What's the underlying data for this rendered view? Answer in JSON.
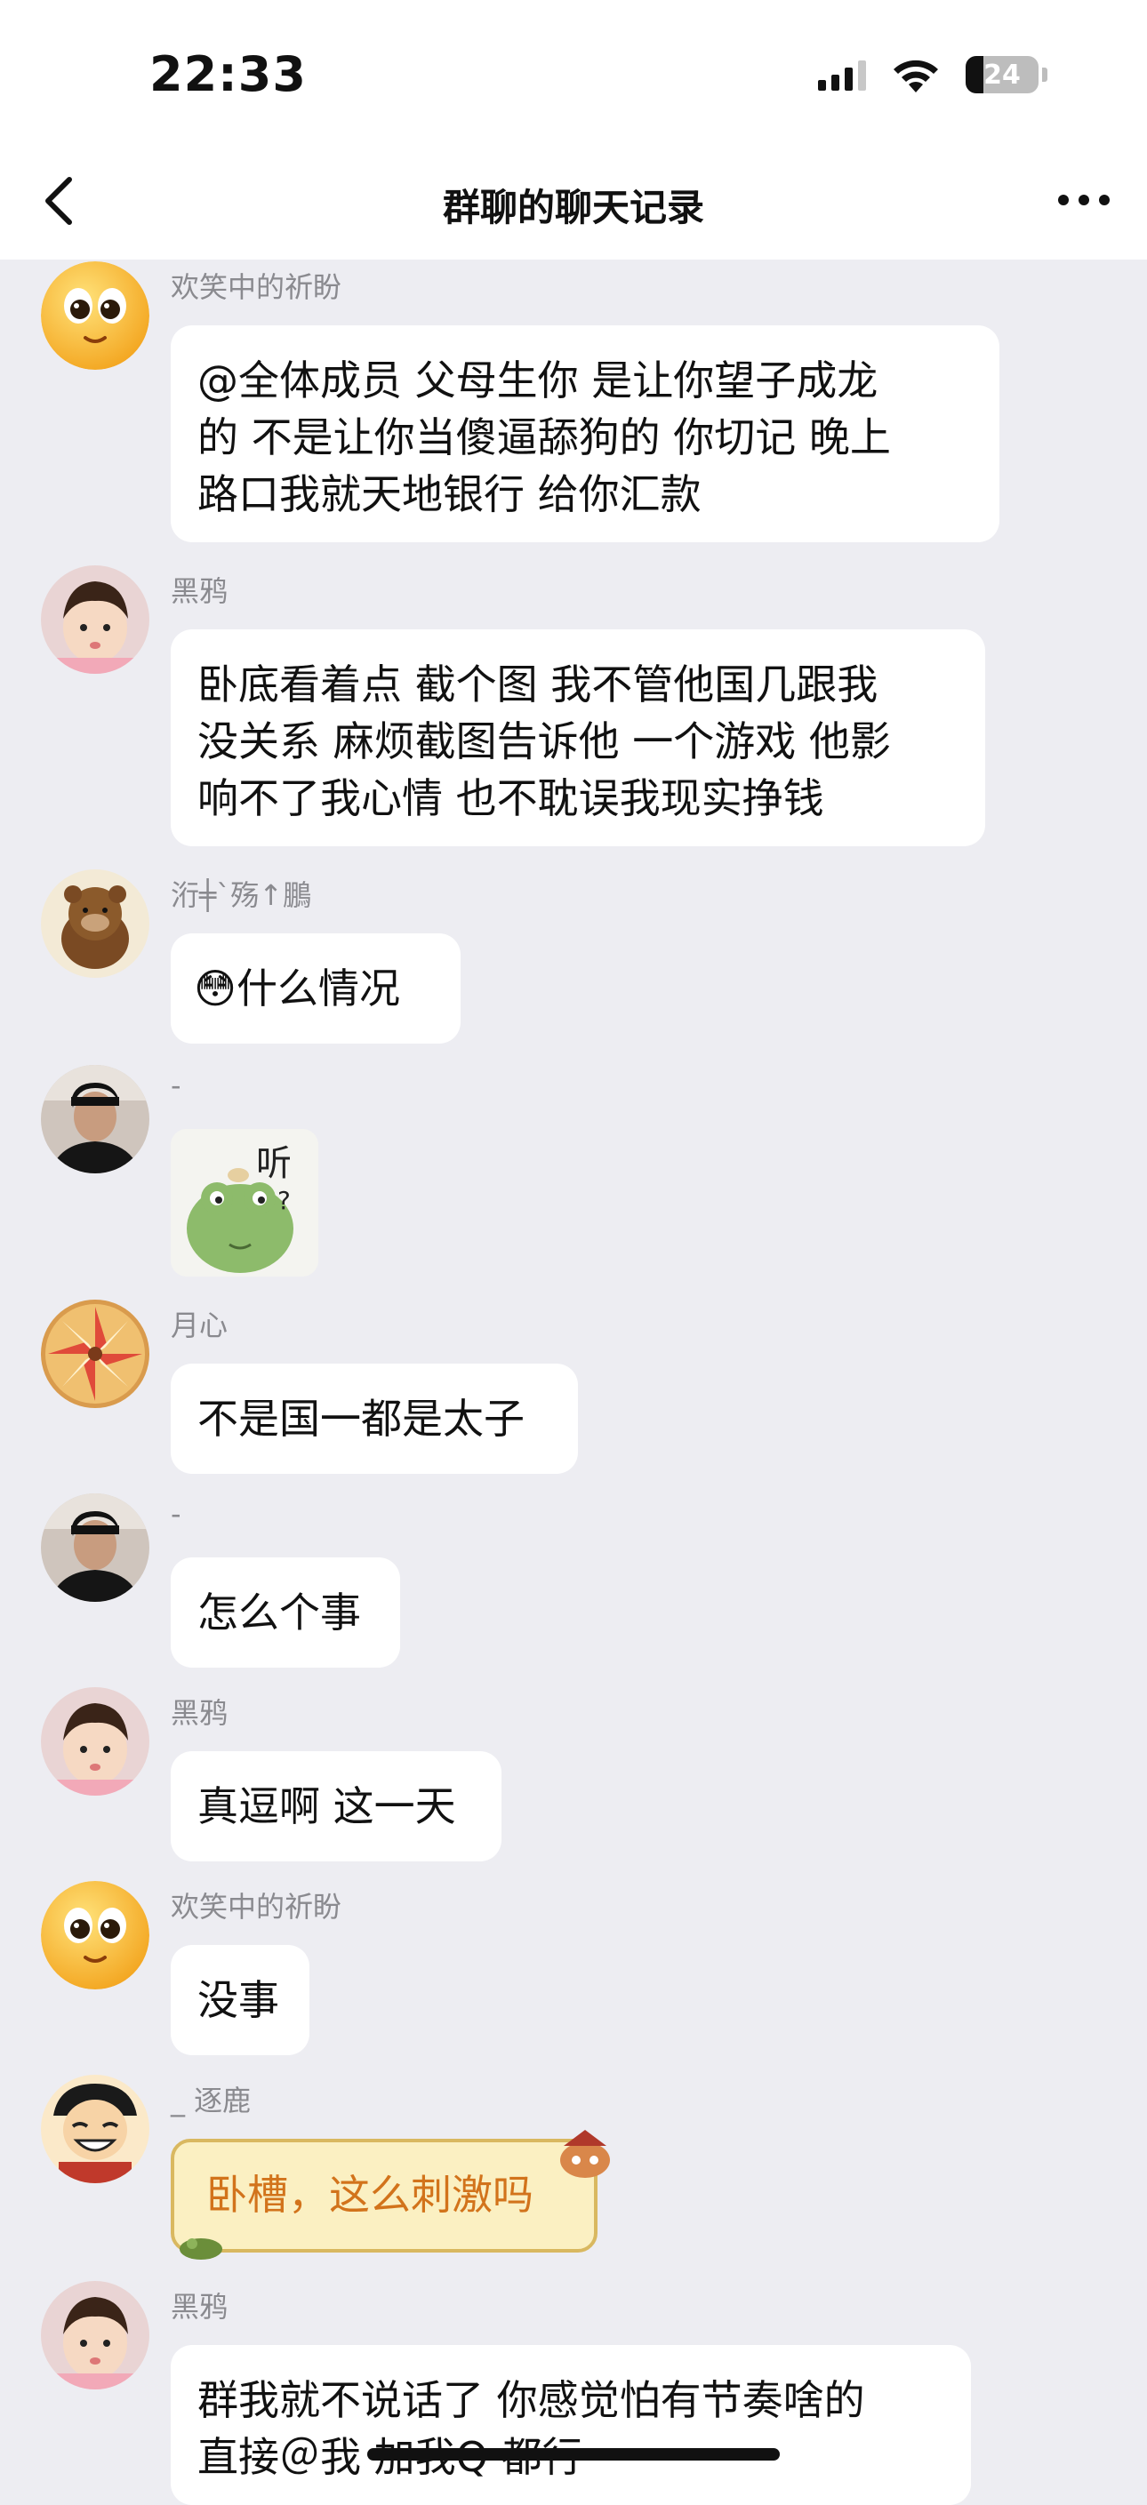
{
  "status_bar": {
    "time": "22:33",
    "battery": "24",
    "battery_level": 0.24
  },
  "nav": {
    "title": "群聊的聊天记录"
  },
  "messages": [
    {
      "sender": "欢笑中的祈盼",
      "lines": [
        "@全体成员 父母生你 是让你望子成龙",
        "的 不是让你当傻逼舔狗的  你切记  晚上",
        "路口我就天地银行 给你汇款"
      ]
    },
    {
      "sender": "黑鸦",
      "lines": [
        "卧底看着点 截个图   我不管他国几跟我",
        "没关系 麻烦截图告诉他 一个游戏 他影",
        "响不了我心情 也不耽误我现实挣钱"
      ]
    },
    {
      "sender": "洐╪ˋ殇↑鵬",
      "lines": [
        "什么情况"
      ],
      "emoji": "😳"
    },
    {
      "sender": "-",
      "sticker": "frog-sticker"
    },
    {
      "sender": "月心",
      "lines": [
        "不是国一都是太子"
      ]
    },
    {
      "sender": "-",
      "lines": [
        "怎么个事"
      ]
    },
    {
      "sender": "黑鸦",
      "lines": [
        "真逗啊 这一天"
      ]
    },
    {
      "sender": "欢笑中的祈盼",
      "lines": [
        "没事"
      ]
    },
    {
      "sender": "_ 逐鹿",
      "lines": [
        "卧槽，这么刺激吗"
      ]
    },
    {
      "sender": "黑鸦",
      "lines": [
        "群我就不说话了  你感觉怕有节奏啥的",
        "直接＠我 加我Q 都行"
      ]
    }
  ]
}
